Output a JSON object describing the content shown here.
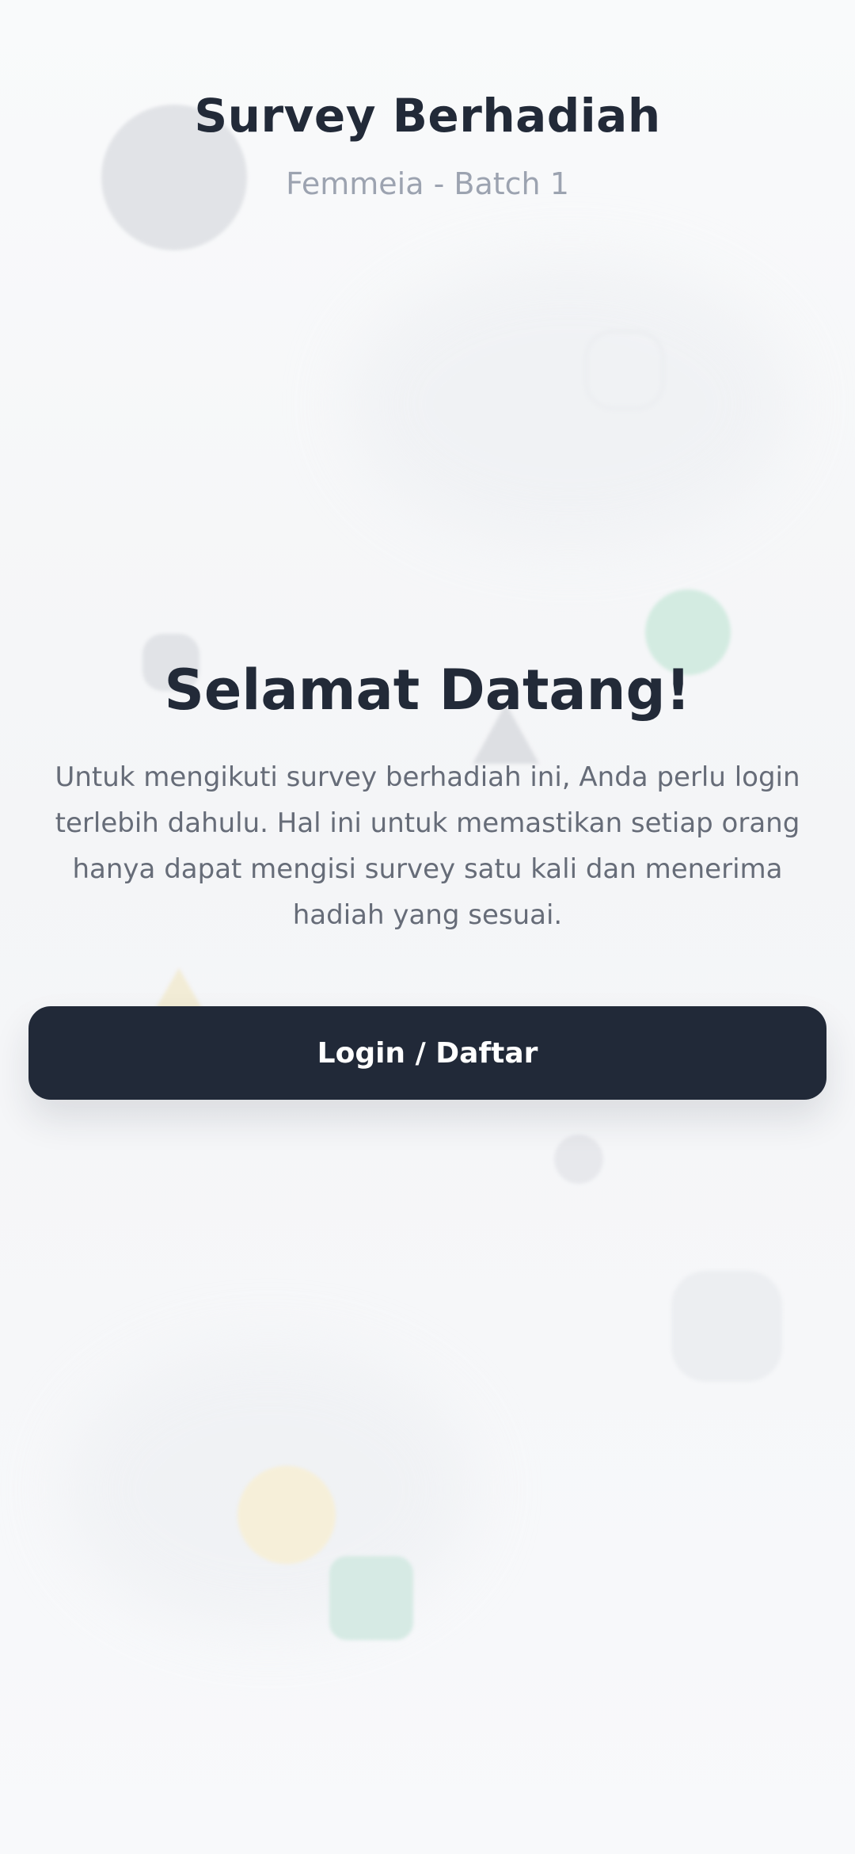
{
  "header": {
    "title": "Survey Berhadiah",
    "subtitle": "Femmeia - Batch 1"
  },
  "welcome": {
    "title": "Selamat Datang!",
    "description": "Untuk mengikuti survey berhadiah ini, Anda perlu login terlebih dahulu. Hal ini untuk memastikan setiap orang hanya dapat mengisi survey satu kali dan menerima hadiah yang sesuai."
  },
  "actions": {
    "login_label": "Login / Daftar"
  },
  "colors": {
    "primary": "#212938",
    "text_dark": "#222a38",
    "text_muted": "#9ca3b0",
    "accent_green": "#d3ebe1",
    "accent_yellow": "#f6efd9"
  }
}
